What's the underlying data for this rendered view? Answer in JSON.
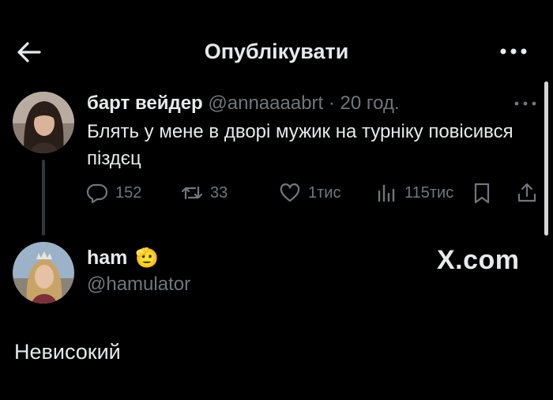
{
  "header": {
    "title": "Опублікувати",
    "back_icon": "arrow-left-icon",
    "more_icon": "more-horizontal-icon"
  },
  "tweet": {
    "name": "барт вейдер",
    "handle": "@annaaaabrt",
    "separator": "·",
    "time": "20 год.",
    "text": "Блять у мене в дворі мужик на турніку повісився піздєц",
    "stats": {
      "replies": "152",
      "reposts": "33",
      "likes": "1тис",
      "views": "115тис"
    }
  },
  "quote": {
    "name": "ham",
    "emoji": "🫡",
    "handle": "@hamulator",
    "brand": "X.com"
  },
  "reply": {
    "text": "Невисокий"
  },
  "colors": {
    "background": "#000000",
    "text": "#e7e9ea",
    "muted": "#71767b"
  }
}
